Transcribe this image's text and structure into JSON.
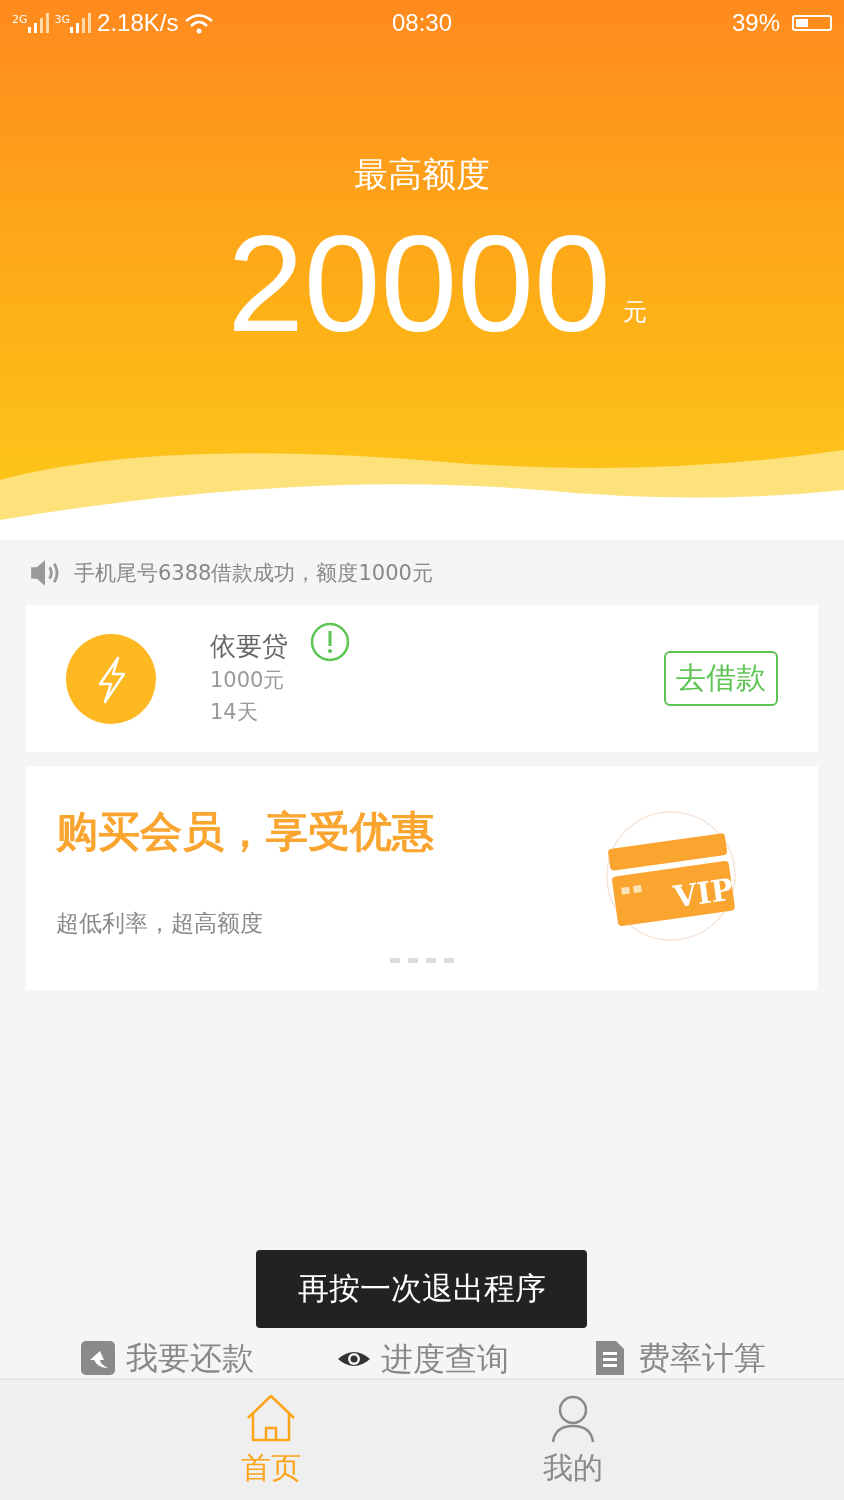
{
  "status_bar": {
    "signal_1": "2G",
    "signal_2": "3G",
    "speed": "2.18K/s",
    "time": "08:30",
    "battery_text": "39%",
    "battery": {
      "level": 0.39
    }
  },
  "header": {
    "label": "最高额度",
    "amount": "20000",
    "unit": "元"
  },
  "notice": "手机尾号6388借款成功，额度1000元",
  "loan": {
    "name": "依要贷",
    "amount": "1000元",
    "term": "14天",
    "button": "去借款"
  },
  "banner": {
    "title": "购买会员，享受优惠",
    "subtitle": "超低利率，超高额度",
    "card_text": "VIP"
  },
  "quick_links": [
    {
      "kind": "repay",
      "label": "我要还款"
    },
    {
      "kind": "progress",
      "label": "进度查询"
    },
    {
      "kind": "rate",
      "label": "费率计算"
    }
  ],
  "toast": "再按一次退出程序",
  "tabs": [
    {
      "kind": "home",
      "label": "首页",
      "selected": true
    },
    {
      "kind": "user",
      "label": "我的",
      "selected": false
    }
  ]
}
